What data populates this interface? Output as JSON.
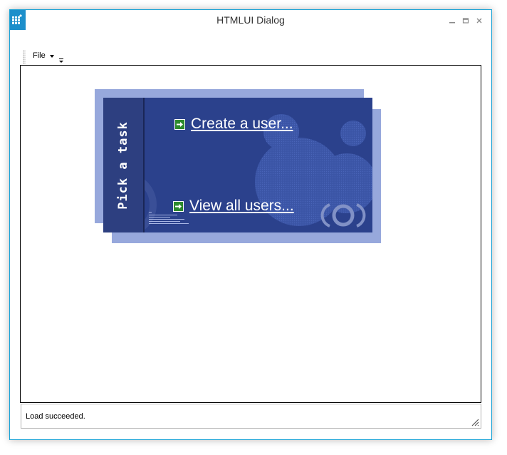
{
  "window": {
    "title": "HTMLUI Dialog",
    "accent_color": "#1aa3d6",
    "controls": [
      "minimize-icon",
      "maximize-icon",
      "close-icon"
    ],
    "control_glyphs": {
      "minimize": "_",
      "maximize": "☐",
      "close": "✕"
    }
  },
  "toolbar": {
    "file_label": "File"
  },
  "task_panel": {
    "side_title": "Pick a task",
    "links": [
      {
        "label": "Create a user..."
      },
      {
        "label": "View all users..."
      }
    ],
    "colors": {
      "card": "#2b418c",
      "shadow": "#97a8dc",
      "link_arrow": "#2d8a2d"
    }
  },
  "status": {
    "text": "Load succeeded."
  }
}
